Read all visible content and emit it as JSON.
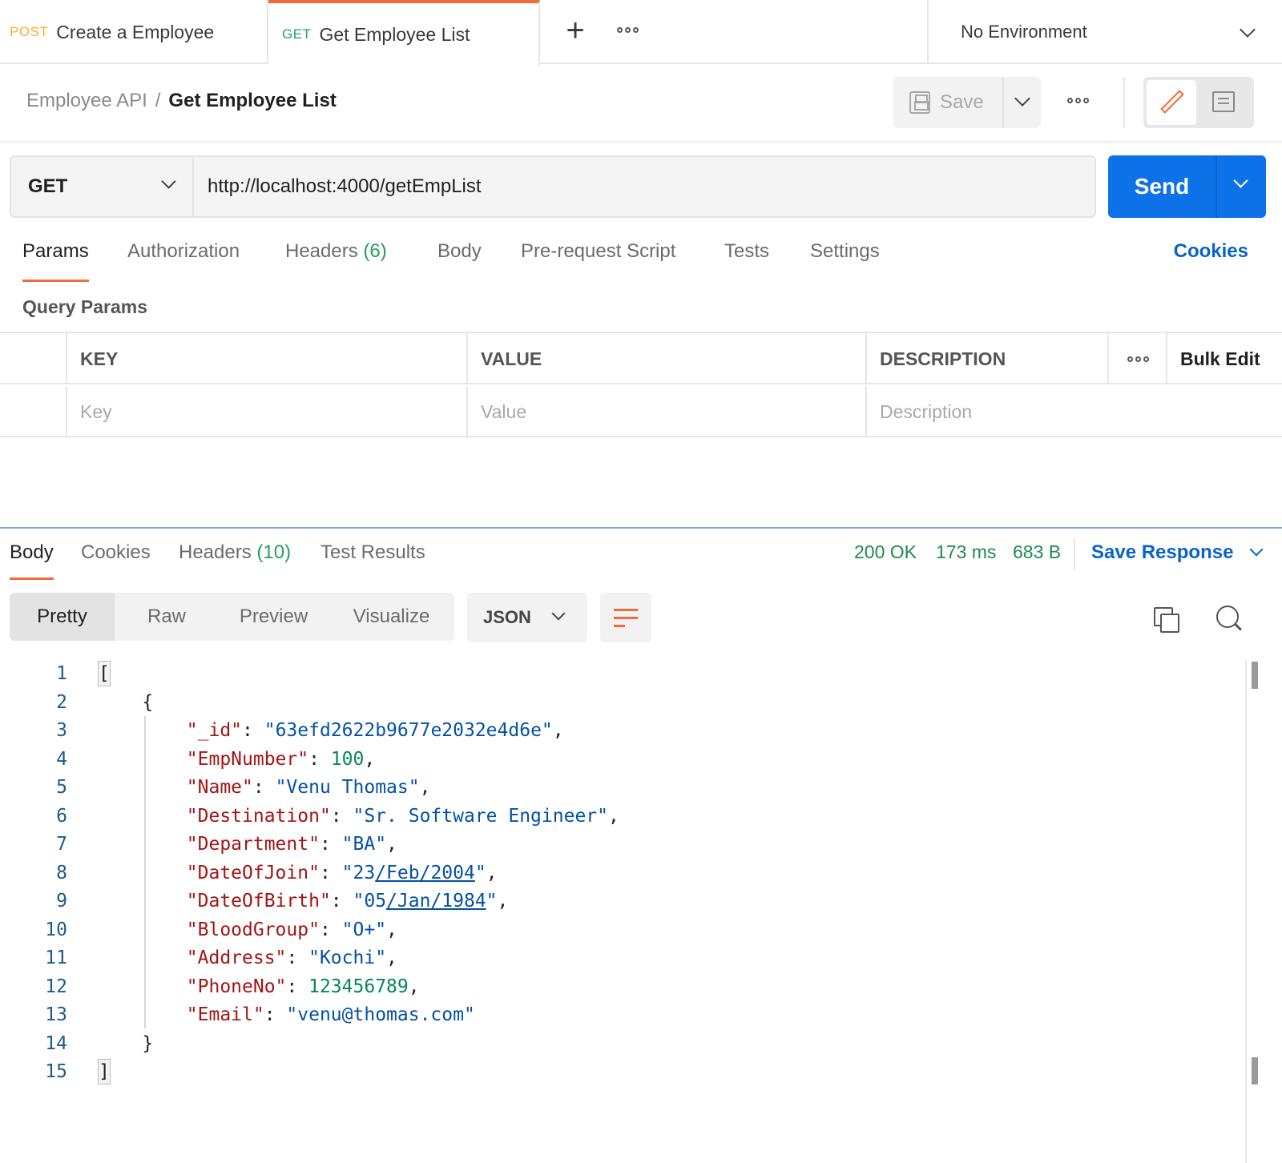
{
  "tabs": [
    {
      "method": "POST",
      "name": "Create a Employee"
    },
    {
      "method": "GET",
      "name": "Get Employee List"
    }
  ],
  "environment": "No Environment",
  "breadcrumb": {
    "parent": "Employee API",
    "separator": "/",
    "current": "Get Employee List"
  },
  "header": {
    "save_label": "Save"
  },
  "request": {
    "method": "GET",
    "url": "http://localhost:4000/getEmpList",
    "send_label": "Send"
  },
  "request_tabs": {
    "params": "Params",
    "authorization": "Authorization",
    "headers": "Headers",
    "headers_count": "(6)",
    "body": "Body",
    "prerequest": "Pre-request Script",
    "tests": "Tests",
    "settings": "Settings",
    "cookies": "Cookies"
  },
  "query_params": {
    "title": "Query Params",
    "columns": {
      "key": "KEY",
      "value": "VALUE",
      "description": "DESCRIPTION",
      "bulk_edit": "Bulk Edit"
    },
    "placeholders": {
      "key": "Key",
      "value": "Value",
      "description": "Description"
    }
  },
  "response_tabs": {
    "body": "Body",
    "cookies": "Cookies",
    "headers": "Headers",
    "headers_count": "(10)",
    "test_results": "Test Results"
  },
  "response_status": {
    "status": "200 OK",
    "time": "173 ms",
    "size": "683 B",
    "save_response": "Save Response"
  },
  "view_modes": {
    "pretty": "Pretty",
    "raw": "Raw",
    "preview": "Preview",
    "visualize": "Visualize",
    "format": "JSON"
  },
  "response_body": {
    "line_numbers": [
      "1",
      "2",
      "3",
      "4",
      "5",
      "6",
      "7",
      "8",
      "9",
      "10",
      "11",
      "12",
      "13",
      "14",
      "15"
    ],
    "open_array": "[",
    "open_obj": "{",
    "close_obj": "}",
    "close_array": "]",
    "fields": {
      "id_key": "\"_id\"",
      "id_val": "\"63efd2622b9677e2032e4d6e\"",
      "empnumber_key": "\"EmpNumber\"",
      "empnumber_val": "100",
      "name_key": "\"Name\"",
      "name_val": "\"Venu Thomas\"",
      "destination_key": "\"Destination\"",
      "destination_val": "\"Sr. Software Engineer\"",
      "department_key": "\"Department\"",
      "department_val": "\"BA\"",
      "dateofjoin_key": "\"DateOfJoin\"",
      "dateofjoin_pre": "\"23",
      "dateofjoin_link": "/Feb/2004",
      "dateofjoin_post": "\"",
      "dateofbirth_key": "\"DateOfBirth\"",
      "dateofbirth_pre": "\"05",
      "dateofbirth_link": "/Jan/1984",
      "dateofbirth_post": "\"",
      "bloodgroup_key": "\"BloodGroup\"",
      "bloodgroup_val": "\"O+\"",
      "address_key": "\"Address\"",
      "address_val": "\"Kochi\"",
      "phoneno_key": "\"PhoneNo\"",
      "phoneno_val": "123456789",
      "email_key": "\"Email\"",
      "email_val": "\"venu@thomas.com\""
    }
  },
  "icons": {
    "tab_plus": "plus-icon",
    "tab_more": "more-icon",
    "env": "chevron-down-icon",
    "save": "save-icon",
    "edit": "pencil-icon",
    "comment": "comment-icon",
    "wrap": "wrap-lines-icon",
    "copy": "copy-icon",
    "search": "search-icon"
  },
  "colors": {
    "accent": "#f26b3a",
    "send": "#0d72e8",
    "link": "#0b63c8",
    "status_ok": "#1f8a4c",
    "post": "#f0b429",
    "get": "#24a05b"
  }
}
